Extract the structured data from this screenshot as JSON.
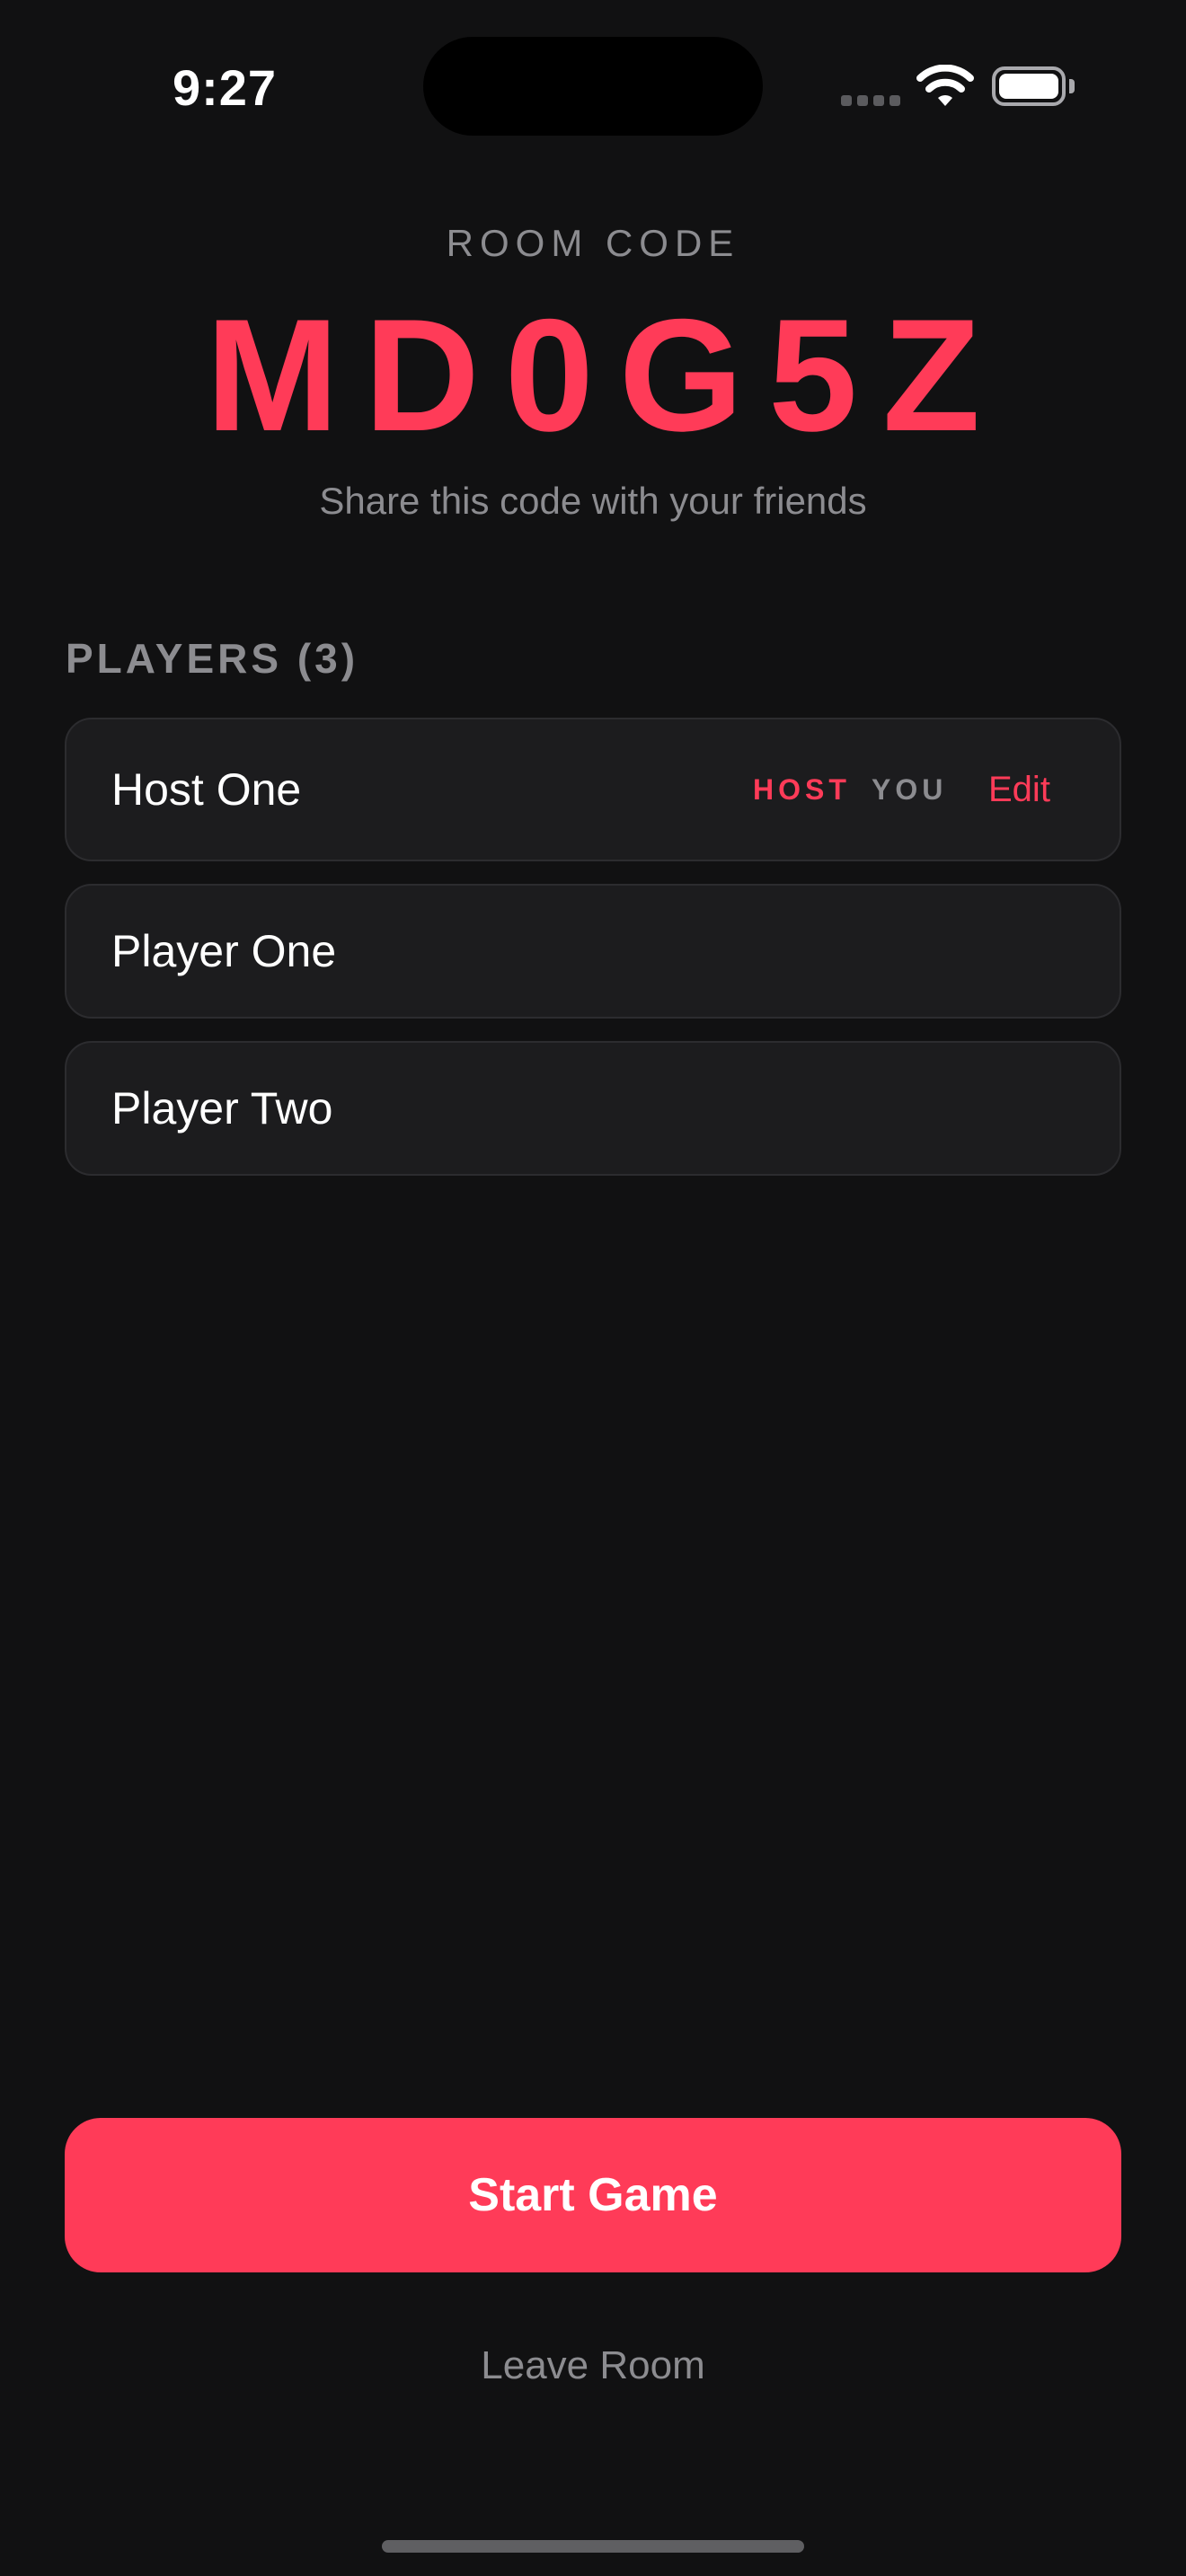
{
  "status_bar": {
    "time": "9:27"
  },
  "room": {
    "label": "ROOM CODE",
    "code": "MD0G5Z",
    "hint": "Share this code with your friends"
  },
  "players": {
    "header": "PLAYERS (3)",
    "items": [
      {
        "name": "Host One",
        "host_badge": "HOST",
        "you_badge": "YOU",
        "edit_label": "Edit"
      },
      {
        "name": "Player One"
      },
      {
        "name": "Player Two"
      }
    ]
  },
  "actions": {
    "start_label": "Start Game",
    "leave_label": "Leave Room"
  },
  "colors": {
    "accent": "#ff3b58",
    "background": "#111112",
    "card": "#1c1c1e",
    "muted_text": "#8c8c90"
  }
}
